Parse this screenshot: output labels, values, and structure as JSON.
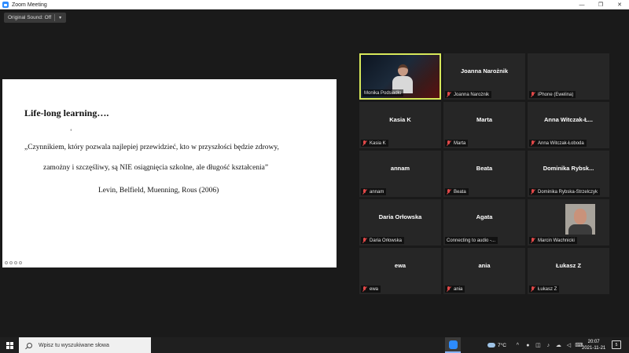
{
  "window": {
    "title": "Zoom Meeting",
    "controls": [
      "—",
      "❐",
      "✕"
    ]
  },
  "meeting": {
    "original_sound": "Original Sound: Off"
  },
  "slide": {
    "title": "Life-long learning….",
    "mark": "‘",
    "line1": "„Czynnikiem, który pozwala najlepiej przewidzieć, kto w przyszłości będzie zdrowy,",
    "line2": "zamożny i szczęśliwy, są NIE osiągnięcia szkolne, ale długość kształcenia”",
    "author": "Levin, Belfield, Muenning, Rous (2006)"
  },
  "participants": [
    {
      "big": "",
      "label": "Monika Podsiadło",
      "muted": false,
      "video": "room",
      "active": true
    },
    {
      "big": "Joanna Narożnik",
      "label": "Joanna Narożnik",
      "muted": true
    },
    {
      "big": "",
      "label": "iPhone (Ewelina)",
      "muted": true
    },
    {
      "big": "Kasia K",
      "label": "Kasia K",
      "muted": true
    },
    {
      "big": "Marta",
      "label": "Marta",
      "muted": true
    },
    {
      "big": "Anna  Witczak-Ł...",
      "label": "Anna Witczak-Łoboda",
      "muted": true
    },
    {
      "big": "annam",
      "label": "annam",
      "muted": true
    },
    {
      "big": "Beata",
      "label": "Beata",
      "muted": true
    },
    {
      "big": "Dominika  Rybsk...",
      "label": "Dominika Rybska-Strzelczyk",
      "muted": true
    },
    {
      "big": "Daria Orłowska",
      "label": "Daria Orłowska",
      "muted": true
    },
    {
      "big": "Agata",
      "label": "Connecting to audio -...",
      "muted": false
    },
    {
      "big": "",
      "label": "Marcin Wachnicki",
      "muted": true,
      "video": "face"
    },
    {
      "big": "ewa",
      "label": "ewa",
      "muted": true
    },
    {
      "big": "ania",
      "label": "ania",
      "muted": true
    },
    {
      "big": "Łukasz Z",
      "label": "Łukasz Z",
      "muted": true
    }
  ],
  "taskbar": {
    "search_placeholder": "Wpisz tu wyszukiwane słowa",
    "weather": "7°C",
    "time": "20:07",
    "date": "2021-11-21",
    "notifications": "5"
  }
}
